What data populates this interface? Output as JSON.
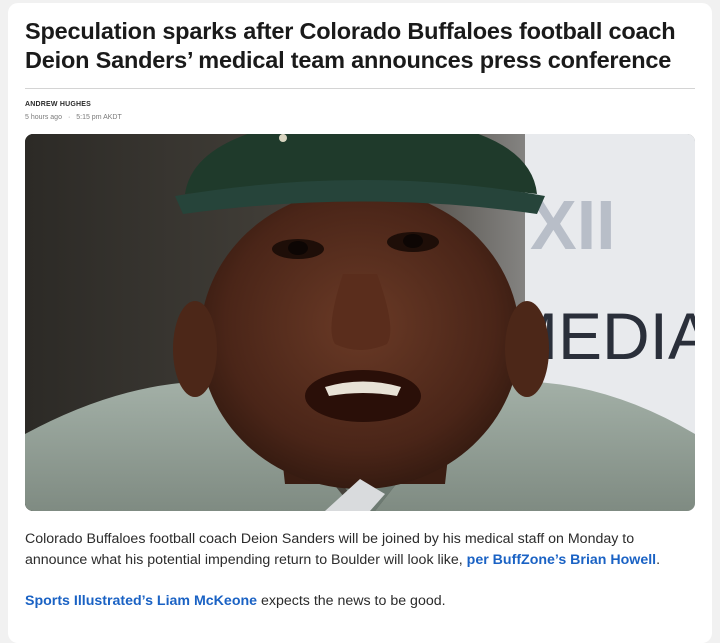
{
  "article": {
    "headline": "Speculation sparks after Colorado Buffaloes football coach Deion Sanders’ medical team announces press conference",
    "author": "ANDREW HUGHES",
    "time_ago": "5 hours ago",
    "separator": "·",
    "time": "5:15 pm AKDT",
    "hero_image": {
      "backdrop_text": "MEDIA D"
    },
    "paragraph1": {
      "text": "Colorado Buffaloes football coach Deion Sanders will be joined by his medical staff on Monday to announce what his potential impending return to Boulder will look like, ",
      "link": "per BuffZone’s Brian Howell",
      "end": "."
    },
    "paragraph2": {
      "link": "Sports Illustrated’s Liam McKeone",
      "text": " expects the news to be good."
    }
  },
  "colors": {
    "link": "#1a62c4",
    "headline": "#1a1a1a",
    "background": "#f1f1f1"
  }
}
